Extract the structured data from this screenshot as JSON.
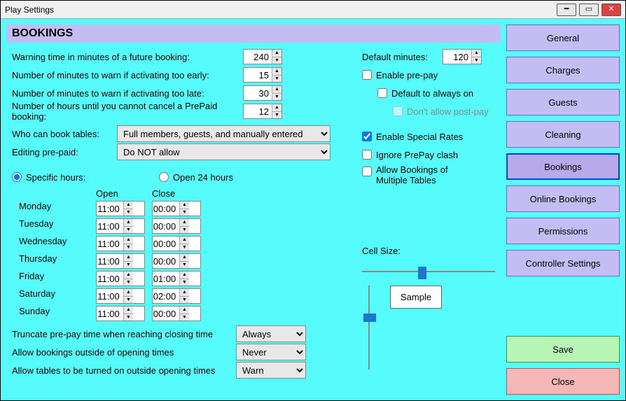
{
  "window": {
    "title": "Play Settings"
  },
  "section_title": "BOOKINGS",
  "labels": {
    "warning_time": "Warning time in minutes of a future booking:",
    "warn_early": "Number of minutes to warn if activating too early:",
    "warn_late": "Number of minutes to warn if activating too late:",
    "cancel_hours": "Number of hours until you cannot cancel a PrePaid booking:",
    "who_can_book": "Who can book tables:",
    "editing_prepaid": "Editing pre-paid:",
    "specific_hours": "Specific hours:",
    "open_24": "Open 24 hours",
    "open": "Open",
    "close": "Close",
    "truncate": "Truncate pre-pay time when reaching closing time",
    "allow_outside": "Allow bookings outside of opening times",
    "allow_tables_outside": "Allow tables to be turned on outside opening times",
    "default_minutes": "Default minutes:",
    "enable_prepay": "Enable pre-pay",
    "default_always": "Default to always on",
    "no_postpay": "Don't allow post-pay",
    "enable_special": "Enable Special Rates",
    "ignore_clash": "Ignore PrePay clash",
    "allow_multi": "Allow Bookings of Multiple Tables",
    "cell_size": "Cell Size:",
    "sample": "Sample"
  },
  "values": {
    "warning_time": "240",
    "warn_early": "15",
    "warn_late": "30",
    "cancel_hours": "12",
    "default_minutes": "120",
    "who_can_book": "Full members, guests, and manually entered",
    "editing_prepaid": "Do NOT allow",
    "truncate": "Always",
    "allow_outside": "Never",
    "allow_tables_outside": "Warn"
  },
  "checks": {
    "enable_prepay": false,
    "default_always": false,
    "no_postpay": false,
    "enable_special": true,
    "ignore_clash": false,
    "allow_multi": false
  },
  "hours_mode": "specific",
  "days": [
    {
      "name": "Monday",
      "open": "11:00",
      "close": "00:00"
    },
    {
      "name": "Tuesday",
      "open": "11:00",
      "close": "00:00"
    },
    {
      "name": "Wednesday",
      "open": "11:00",
      "close": "00:00"
    },
    {
      "name": "Thursday",
      "open": "11:00",
      "close": "00:00"
    },
    {
      "name": "Friday",
      "open": "11:00",
      "close": "01:00"
    },
    {
      "name": "Saturday",
      "open": "11:00",
      "close": "02:00"
    },
    {
      "name": "Sunday",
      "open": "11:00",
      "close": "00:00"
    }
  ],
  "nav": [
    "General",
    "Charges",
    "Guests",
    "Cleaning",
    "Bookings",
    "Online Bookings",
    "Permissions",
    "Controller Settings"
  ],
  "nav_selected": 4,
  "actions": {
    "save": "Save",
    "close": "Close"
  }
}
